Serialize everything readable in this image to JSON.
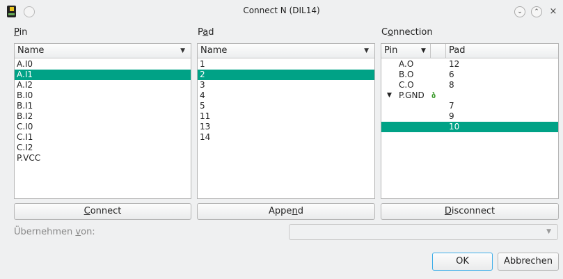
{
  "window": {
    "title": "Connect N (DIL14)",
    "min_glyph": "⌄",
    "max_glyph": "⌃",
    "close_glyph": "×"
  },
  "pin_panel": {
    "label": "Pin",
    "header": "Name",
    "items": [
      "A.I0",
      "A.I1",
      "A.I2",
      "B.I0",
      "B.I1",
      "B.I2",
      "C.I0",
      "C.I1",
      "C.I2",
      "P.VCC"
    ],
    "selected_index": 1
  },
  "pad_panel": {
    "label": "Pad",
    "header": "Name",
    "items": [
      "1",
      "2",
      "3",
      "4",
      "5",
      "11",
      "13",
      "14"
    ],
    "selected_index": 1
  },
  "connection_panel": {
    "label": "Connection",
    "header_pin": "Pin",
    "header_pad": "Pad",
    "rows": [
      {
        "pin": "A.O",
        "pad": "12"
      },
      {
        "pin": "B.O",
        "pad": "6"
      },
      {
        "pin": "C.O",
        "pad": "8"
      },
      {
        "pin": "P.GND",
        "pad": "",
        "expanded": true,
        "icon": "link-icon"
      },
      {
        "pin": "",
        "pad": "7"
      },
      {
        "pin": "",
        "pad": "9"
      },
      {
        "pin": "",
        "pad": "10",
        "selected": true
      }
    ]
  },
  "buttons": {
    "connect": "Connect",
    "append": "Append",
    "disconnect": "Disconnect",
    "ok": "OK",
    "cancel": "Abbrechen"
  },
  "take_over": {
    "label": "Übernehmen von:",
    "value": ""
  },
  "colors": {
    "selection": "#00a286",
    "focus": "#3daee9"
  }
}
